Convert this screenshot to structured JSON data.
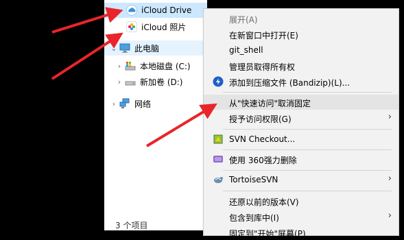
{
  "nav": {
    "items": [
      {
        "label": "iCloud Drive",
        "icon": "icloud-drive-icon"
      },
      {
        "label": "iCloud 照片",
        "icon": "icloud-photos-icon"
      },
      {
        "label": "此电脑",
        "icon": "this-pc-icon"
      },
      {
        "label": "本地磁盘 (C:)",
        "icon": "local-disk-icon"
      },
      {
        "label": "新加卷 (D:)",
        "icon": "drive-d-icon"
      },
      {
        "label": "网络",
        "icon": "network-icon"
      }
    ],
    "status": "3 个项目"
  },
  "context_menu": {
    "items": [
      {
        "label": "展开(A)",
        "disabled": true
      },
      {
        "label": "在新窗口中打开(E)"
      },
      {
        "label": "git_shell"
      },
      {
        "label": "管理员取得所有权"
      },
      {
        "label": "添加到压缩文件 (Bandizip)(L)...",
        "icon": "bandizip-icon"
      },
      {
        "label": "从\"快速访问\"取消固定",
        "highlighted": true
      },
      {
        "label": "授予访问权限(G)",
        "submenu": true
      },
      {
        "label": "SVN Checkout...",
        "icon": "svn-checkout-icon"
      },
      {
        "label": "使用 360强力删除",
        "icon": "360-delete-icon"
      },
      {
        "label": "TortoiseSVN",
        "icon": "tortoisesvn-icon",
        "submenu": true
      },
      {
        "label": "还原以前的版本(V)"
      },
      {
        "label": "包含到库中(I)",
        "submenu": true
      },
      {
        "label": "固定到\"开始\"屏幕(P)"
      }
    ],
    "submenu_glyph": "›"
  },
  "colors": {
    "selected_bg": "#cce8ff",
    "hover_bg": "#e5f3ff",
    "menu_bg": "#f2f2f2",
    "highlight_bg": "#e4e4e4",
    "arrow": "#e8252a"
  }
}
